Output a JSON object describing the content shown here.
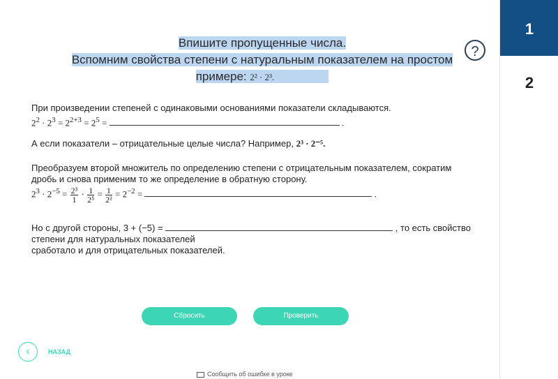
{
  "task": {
    "heading_line1": "Впишите пропущенные числа.",
    "heading_line2": "Вспомним свойства степени с натуральным показателем на простом",
    "heading_line3": "примере:",
    "heading_formula": "2² · 2³."
  },
  "nav": {
    "items": [
      "1",
      "2"
    ],
    "active": "1"
  },
  "help_icon_label": "?",
  "paragraphs": {
    "p1_text": "При произведении степеней с одинаковыми основаниями показатели складываются.",
    "p2_text": "А если показатели – отрицательные целые числа? Например,",
    "p2_formula": "2³ · 2⁻⁵.",
    "p3_line1": "Преобразуем второй множитель по определению степени с отрицательным показателем, сократим",
    "p3_line2": "дробь и снова применим то же определение в обратную сторону.",
    "p4_pre": "Но с другой стороны, 3 + (−5) =",
    "p4_post": ", то есть свойство",
    "p4_line2": "степени для натуральных показателей",
    "p4_line3": "сработало и для отрицательных показателей."
  },
  "formula1": {
    "a": "2",
    "a_exp": "2",
    "b": "2",
    "b_exp": "3",
    "c": "2",
    "c_exp": "2+3",
    "d": "2",
    "d_exp": "5"
  },
  "formula2": {
    "a": "2",
    "a_exp": "3",
    "b": "2",
    "b_exp": "−5",
    "f1_num": "2³",
    "f1_den": "1",
    "f2_num": "1",
    "f2_den": "2⁵",
    "f3_num": "1",
    "f3_den": "2²",
    "r": "2",
    "r_exp": "−2"
  },
  "buttons": {
    "reset": "Сбросить",
    "check": "Проверить"
  },
  "back_label": "НАЗАД",
  "report_label": "Сообщить об ошибке в уроке",
  "colors": {
    "accent": "#3dd6b5",
    "nav_active": "#124f84",
    "highlight": "#bcd6f2"
  }
}
